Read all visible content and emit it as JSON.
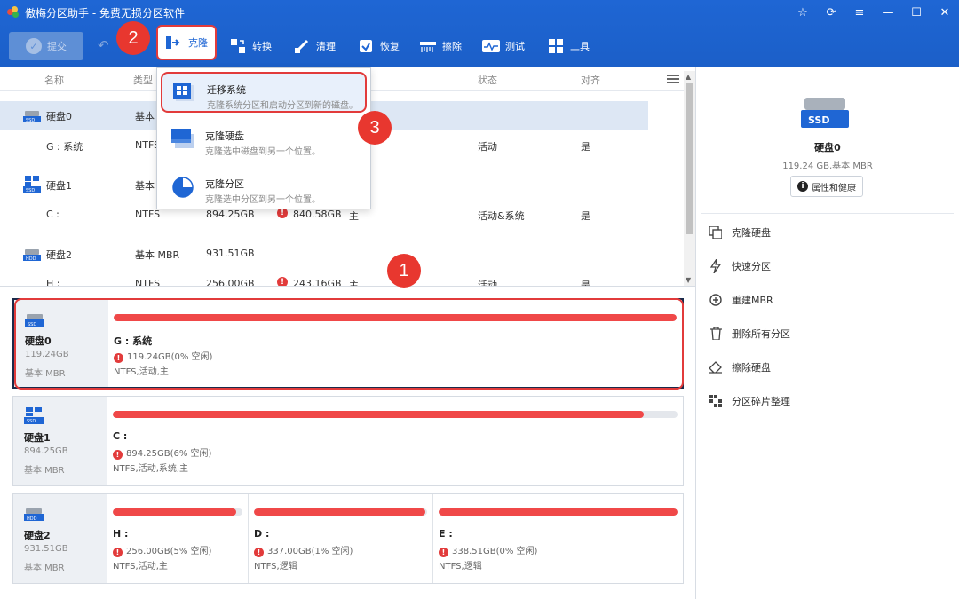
{
  "window": {
    "title": "傲梅分区助手 - 免费无损分区软件",
    "controls": [
      "star-icon",
      "refresh-icon",
      "menu-icon",
      "minimize-icon",
      "maximize-icon",
      "close-icon"
    ]
  },
  "toolbar": {
    "submit_label": "提交",
    "items": [
      {
        "label": "克隆",
        "icon": "clone-icon"
      },
      {
        "label": "转换",
        "icon": "convert-icon"
      },
      {
        "label": "清理",
        "icon": "clean-icon"
      },
      {
        "label": "恢复",
        "icon": "recover-icon"
      },
      {
        "label": "擦除",
        "icon": "wipe-icon"
      },
      {
        "label": "测试",
        "icon": "test-icon"
      },
      {
        "label": "工具",
        "icon": "tools-icon"
      }
    ]
  },
  "list": {
    "columns": [
      "名称",
      "类型",
      "状态",
      "对齐"
    ],
    "rows": [
      {
        "name": "硬盘0",
        "type": "基本",
        "capacity": "",
        "free": "",
        "fs_mode": "",
        "status": "",
        "align": ""
      },
      {
        "name": "G : 系统",
        "type": "NTFS",
        "capacity": "",
        "free": "",
        "fs_mode": "",
        "status": "活动",
        "align": "是"
      },
      {
        "name": "硬盘1",
        "type": "基本",
        "capacity": "",
        "free": "",
        "fs_mode": "",
        "status": "",
        "align": ""
      },
      {
        "name": "C :",
        "type": "NTFS",
        "capacity": "894.25GB",
        "free": "840.58GB",
        "fs_mode": "主",
        "status": "活动&系统",
        "align": "是"
      },
      {
        "name": "硬盘2",
        "type": "基本 MBR",
        "capacity": "931.51GB",
        "free": "",
        "fs_mode": "",
        "status": "",
        "align": ""
      },
      {
        "name": "H :",
        "type": "NTFS",
        "capacity": "256.00GB",
        "free": "243.16GB",
        "fs_mode": "主",
        "status": "活动",
        "align": "是"
      }
    ]
  },
  "dropdown": {
    "items": [
      {
        "title": "迁移系统",
        "desc": "克隆系统分区和启动分区到新的磁盘。"
      },
      {
        "title": "克隆硬盘",
        "desc": "克隆选中磁盘到另一个位置。"
      },
      {
        "title": "克隆分区",
        "desc": "克隆选中分区到另一个位置。"
      }
    ]
  },
  "badges": [
    "1",
    "2",
    "3"
  ],
  "disks": [
    {
      "name": "硬盘0",
      "size": "119.24GB",
      "type": "基本 MBR",
      "icon": "SSD",
      "partitions": [
        {
          "label": "G : 系统",
          "info": "119.24GB(0% 空闲)",
          "fs": "NTFS,活动,主",
          "used": 1.0
        }
      ]
    },
    {
      "name": "硬盘1",
      "size": "894.25GB",
      "type": "基本 MBR",
      "icon": "SSD",
      "partitions": [
        {
          "label": "C :",
          "info": "894.25GB(6% 空闲)",
          "fs": "NTFS,活动,系统,主",
          "used": 0.94
        }
      ]
    },
    {
      "name": "硬盘2",
      "size": "931.51GB",
      "type": "基本 MBR",
      "icon": "HDD",
      "partitions": [
        {
          "label": "H :",
          "info": "256.00GB(5% 空闲)",
          "fs": "NTFS,活动,主",
          "used": 0.95
        },
        {
          "label": "D :",
          "info": "337.00GB(1% 空闲)",
          "fs": "NTFS,逻辑",
          "used": 0.99
        },
        {
          "label": "E :",
          "info": "338.51GB(0% 空闲)",
          "fs": "NTFS,逻辑",
          "used": 1.0
        }
      ]
    }
  ],
  "right_panel": {
    "disk_name": "硬盘0",
    "disk_info": "119.24 GB,基本 MBR",
    "ssd_label": "SSD",
    "prop_button": "属性和健康",
    "operations": [
      {
        "label": "克隆硬盘",
        "icon": "clone-disk-icon"
      },
      {
        "label": "快速分区",
        "icon": "lightning-icon"
      },
      {
        "label": "重建MBR",
        "icon": "rebuild-mbr-icon"
      },
      {
        "label": "删除所有分区",
        "icon": "trash-icon"
      },
      {
        "label": "擦除硬盘",
        "icon": "eraser-icon"
      },
      {
        "label": "分区碎片整理",
        "icon": "defrag-icon"
      }
    ]
  },
  "colors": {
    "title_bar": "#1f66d4",
    "bar_fill": "#f04848",
    "callout": "#e8372f",
    "selection": "#dde7f4"
  }
}
